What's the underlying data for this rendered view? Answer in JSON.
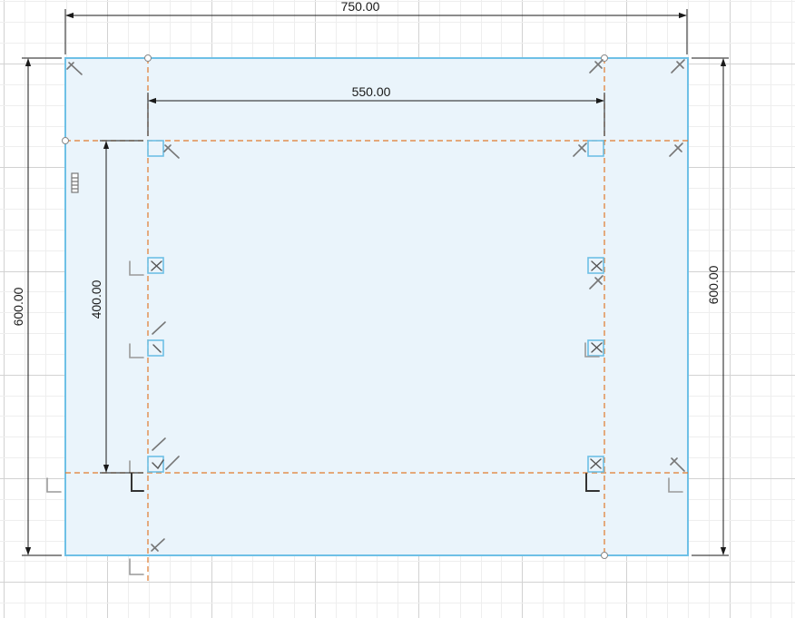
{
  "sketch": {
    "colors": {
      "background": "#ffffff",
      "grid_minor": "#eeeeee",
      "grid_major": "#d2d2d2",
      "profile_fill": "#eaf4fb",
      "profile_edge": "#6ec0e6",
      "construction_line": "#e07a2c",
      "dimension_line": "#1a1a1a",
      "glyph": "#777777",
      "glyph_dark": "#333333"
    },
    "dimensions": {
      "overall_width": "750.00",
      "inner_width": "550.00",
      "overall_height_left": "600.00",
      "overall_height_right": "600.00",
      "inner_height": "400.00"
    },
    "constraint_icons": [
      "horizontal-vertical-constraint-icon",
      "perpendicular-constraint-icon",
      "coincident-constraint-icon",
      "equal-constraint-icon",
      "parallel-constraint-icon",
      "midpoint-constraint-icon"
    ]
  }
}
